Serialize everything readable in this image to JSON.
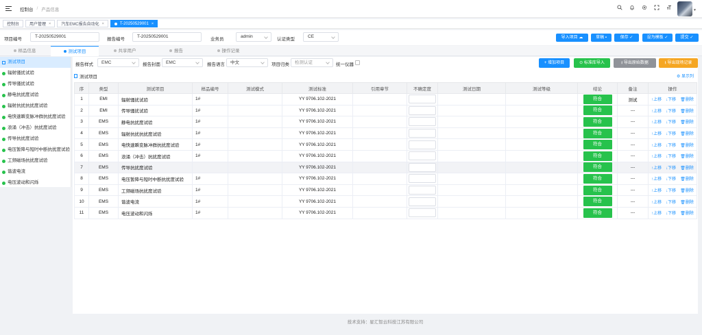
{
  "header": {
    "breadcrumb": [
      "控制台",
      "产品信息"
    ],
    "icons": [
      "search-icon",
      "bell-icon",
      "gear-icon",
      "fullscreen-icon",
      "font-size-icon"
    ]
  },
  "tags": [
    {
      "label": "控制台",
      "closable": false
    },
    {
      "label": "用户管理",
      "closable": true
    },
    {
      "label": "汽车EMC报告自动化",
      "closable": true
    },
    {
      "label": "T-20250529001",
      "closable": true,
      "active": true
    }
  ],
  "form": {
    "project_no_label": "项目编号",
    "project_no_value": "T-20250529001",
    "report_no_label": "报告编号",
    "report_no_value": "T-20250529001",
    "salesman_label": "业务员",
    "salesman_value": "admin",
    "cert_type_label": "认证类型",
    "cert_type_value": "CE",
    "buttons": [
      "导入项目",
      "草稿",
      "保存",
      "设为模板",
      "提交"
    ]
  },
  "section_tabs": [
    "样品信息",
    "测试项目",
    "共享用户",
    "报告",
    "操作记录"
  ],
  "sidebar": {
    "items": [
      "测试项目",
      "辐射骚扰试验",
      "传导骚扰试验",
      "静电抗扰度试验",
      "辐射抗扰抗扰度试验",
      "电快速瞬变脉冲群抗扰度试验",
      "浪涌（冲击）抗扰度试验",
      "传导抗扰度试验",
      "电压暂降与短时中断抗扰度试验",
      "工频磁场抗扰度试验",
      "谐波电流",
      "电压波动和闪烁"
    ]
  },
  "toolbar": {
    "report_style_label": "报告样式",
    "report_style_value": "EMC",
    "report_cover_label": "报告封面",
    "report_cover_value": "EMC",
    "report_lang_label": "报告语言",
    "report_lang_value": "中文",
    "project_category_label": "项目归类",
    "project_category_value": "检测认证",
    "unified_instrument_label": "统一仪器",
    "buttons": [
      "增加项目",
      "标准库导入",
      "导出原始数据",
      "导出现场记录"
    ]
  },
  "table": {
    "title": "测试项目",
    "show_columns": "显示列",
    "columns": [
      "序",
      "类型",
      "测试项目",
      "样品编号",
      "测试模式",
      "测试标准",
      "引用章节",
      "不确定度",
      "测试日期",
      "测试등级",
      "结论",
      "备注",
      "操作"
    ],
    "rows": [
      {
        "no": "1",
        "type": "EMI",
        "item": "辐射骚扰试验",
        "sample": "1#",
        "standard": "YY 9706.102-2021",
        "result": "符合",
        "remark": "测试"
      },
      {
        "no": "2",
        "type": "EMI",
        "item": "传导骚扰试验",
        "sample": "1#",
        "standard": "YY 9706.102-2021",
        "result": "符合",
        "remark": "---"
      },
      {
        "no": "3",
        "type": "EMS",
        "item": "静电抗扰度试验",
        "sample": "1#",
        "standard": "YY 9706.102-2021",
        "result": "符合",
        "remark": "---"
      },
      {
        "no": "4",
        "type": "EMS",
        "item": "辐射抗扰抗扰度试验",
        "sample": "1#",
        "standard": "YY 9706.102-2021",
        "result": "符合",
        "remark": "---"
      },
      {
        "no": "5",
        "type": "EMS",
        "item": "电快速瞬变脉冲群抗扰度试验",
        "sample": "1#",
        "standard": "YY 9706.102-2021",
        "result": "符合",
        "remark": "---"
      },
      {
        "no": "6",
        "type": "EMS",
        "item": "浪涌（冲击）抗扰度试验",
        "sample": "1#",
        "standard": "YY 9706.102-2021",
        "result": "符合",
        "remark": "---"
      },
      {
        "no": "7",
        "type": "EMS",
        "item": "传导抗扰度试验",
        "sample": "",
        "standard": "YY 9706.102-2021",
        "result": "符合",
        "remark": "---"
      },
      {
        "no": "8",
        "type": "EMS",
        "item": "电压暂降与短时中断抗扰度试验",
        "sample": "1#",
        "standard": "YY 9706.102-2021",
        "result": "符合",
        "remark": "---"
      },
      {
        "no": "9",
        "type": "EMS",
        "item": "工频磁场抗扰度试验",
        "sample": "1#",
        "standard": "YY 9706.102-2021",
        "result": "符合",
        "remark": "---"
      },
      {
        "no": "10",
        "type": "EMS",
        "item": "谐波电流",
        "sample": "1#",
        "standard": "YY 9706.102-2021",
        "result": "符合",
        "remark": "---"
      },
      {
        "no": "11",
        "type": "EMS",
        "item": "电压波动和闪烁",
        "sample": "1#",
        "standard": "YY 9706.102-2021",
        "result": "符合",
        "remark": "---"
      }
    ],
    "ops": [
      "↑上移",
      "↓下移",
      "删除"
    ]
  },
  "footer": "技术支持：星汇智云科技江苏有限公司",
  "colors": {
    "primary": "#1890ff",
    "success": "#27c24c",
    "gray": "#909399",
    "warning": "#f5a623"
  }
}
